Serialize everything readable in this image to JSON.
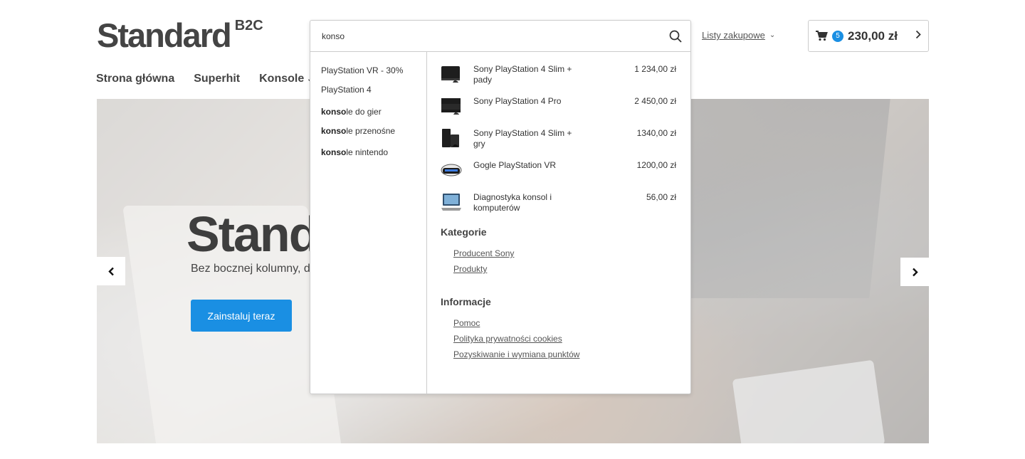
{
  "logo": {
    "main": "Standard",
    "sup": "B2C"
  },
  "header": {
    "lists_label": "Listy zakupowe ",
    "cart": {
      "count": "5",
      "total": "230,00 zł"
    }
  },
  "nav": [
    {
      "label": "Strona główna"
    },
    {
      "label": "Superhit"
    },
    {
      "label": "Konsole"
    }
  ],
  "hero": {
    "title": "Standard",
    "subtitle": "Bez bocznej kolumny, d",
    "button": "Zainstaluj teraz"
  },
  "search": {
    "value": "konso",
    "suggestions": [
      {
        "bold": "",
        "rest": "PlayStation VR - 30%"
      },
      {
        "bold": "",
        "rest": "PlayStation 4"
      },
      {
        "bold": "konso",
        "rest": "le do gier"
      },
      {
        "bold": "konso",
        "rest": "le przenośne"
      },
      {
        "bold": "konso",
        "rest": "le nintendo"
      }
    ],
    "products": [
      {
        "name": "Sony PlayStation 4 Slim + pady",
        "price": "1 234,00 zł",
        "icon": "ps4-slim-icon"
      },
      {
        "name": "Sony PlayStation 4 Pro",
        "price": "2 450,00 zł",
        "icon": "ps4-pro-icon"
      },
      {
        "name": "Sony PlayStation 4 Slim + gry",
        "price": "1340,00 zł",
        "icon": "ps4-slim-games-icon"
      },
      {
        "name": "Gogle PlayStation VR",
        "price": "1200,00 zł",
        "icon": "vr-headset-icon"
      },
      {
        "name": "Diagnostyka konsol i komputerów",
        "price": "56,00 zł",
        "icon": "laptop-icon"
      }
    ],
    "categories_title": "Kategorie",
    "categories": [
      "Producent Sony",
      "Produkty"
    ],
    "info_title": "Informacje",
    "info": [
      "Pomoc",
      "Polityka prywatności cookies",
      "Pozyskiwanie i wymiana punktów"
    ]
  },
  "colors": {
    "accent": "#1a8fe3",
    "text": "#333333",
    "border": "#cccccc"
  }
}
